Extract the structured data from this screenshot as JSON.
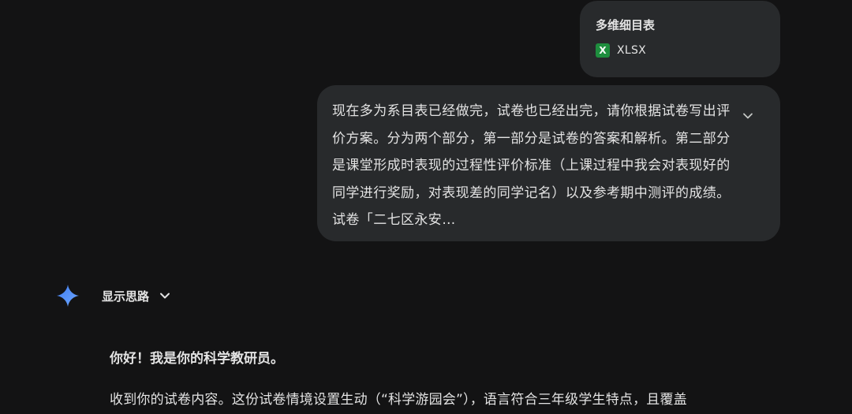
{
  "attachment": {
    "file_name": "多维细目表",
    "icon_letter": "X",
    "file_type": "XLSX",
    "icon_color": "#1e8e3e"
  },
  "user_message": {
    "text": "现在多为系目表已经做完，试卷也已经出完，请你根据试卷写出评价方案。分为两个部分，第一部分是试卷的答案和解析。第二部分是课堂形成时表现的过程性评价标准（上课过程中我会对表现好的同学进行奖励，对表现差的同学记名）以及参考期中测评的成绩。试卷「二七区永安…",
    "expand_icon": "chevron-down-icon"
  },
  "assistant": {
    "logo_icon": "gemini-sparkle-icon",
    "logo_color": "#4f8ff7",
    "thinking_label": "显示思路",
    "paragraphs": [
      "你好！我是你的科学教研员。",
      "收到你的试卷内容。这份试卷情境设置生动（“科学游园会”），语言符合三年级学生特点，且覆盖"
    ]
  },
  "colors": {
    "background": "#131314",
    "bubble": "#282a2c",
    "text": "#e3e3e3"
  }
}
